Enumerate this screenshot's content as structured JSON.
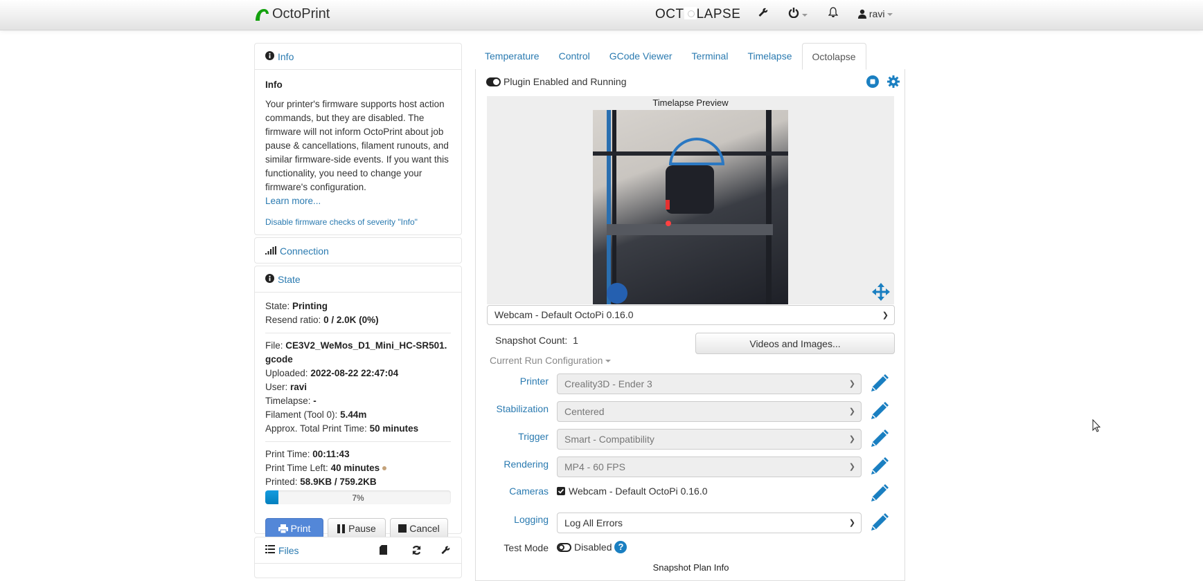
{
  "navbar": {
    "brand": "OctoPrint",
    "plugin_logo_left": "OCT",
    "plugin_logo_right": "LAPSE",
    "icons": [
      "wrench-icon",
      "power-icon",
      "bell-icon",
      "user-icon"
    ],
    "user": "ravi"
  },
  "sidebar": {
    "info_panel": {
      "title": "Info",
      "heading": "Info",
      "message": "Your printer's firmware supports host action commands, but they are disabled. The firmware will not inform OctoPrint about job pause & cancellations, filament runouts, and similar firmware-side events. If you want this functionality, you need to change your firmware's configuration.",
      "learn_more": "Learn more...",
      "disable_link": "Disable firmware checks of severity \"Info\""
    },
    "connection_panel": {
      "title": "Connection"
    },
    "state_panel": {
      "title": "State",
      "state_label": "State:",
      "state_value": "Printing",
      "resend_label": "Resend ratio:",
      "resend_value": "0 / 2.0K (0%)",
      "file_label": "File:",
      "file_value": "CE3V2_WeMos_D1_Mini_HC-SR501.gcode",
      "uploaded_label": "Uploaded:",
      "uploaded_value": "2022-08-22 22:47:04",
      "user_label": "User:",
      "user_value": "ravi",
      "timelapse_label": "Timelapse:",
      "timelapse_value": "-",
      "filament_label": "Filament (Tool 0):",
      "filament_value": "5.44m",
      "approx_label": "Approx. Total Print Time:",
      "approx_value": "50 minutes",
      "print_time_label": "Print Time:",
      "print_time_value": "00:11:43",
      "time_left_label": "Print Time Left:",
      "time_left_value": "40 minutes",
      "printed_label": "Printed:",
      "printed_value": "58.9KB / 759.2KB",
      "progress_percent": 7,
      "progress_text": "7%",
      "print_button": "Print",
      "pause_button": "Pause",
      "cancel_button": "Cancel"
    },
    "files_panel": {
      "title": "Files"
    }
  },
  "tabs": [
    "Temperature",
    "Control",
    "GCode Viewer",
    "Terminal",
    "Timelapse",
    "Octolapse"
  ],
  "active_tab": "Octolapse",
  "octolapse": {
    "plugin_status": "Plugin Enabled and Running",
    "preview_title": "Timelapse Preview",
    "camera_select": "Webcam - Default OctoPi 0.16.0",
    "snapshot_count_label": "Snapshot Count:",
    "snapshot_count_value": "1",
    "videos_button": "Videos and Images...",
    "current_run_config": "Current Run Configuration",
    "settings": [
      {
        "label": "Printer",
        "value": "Creality3D - Ender 3"
      },
      {
        "label": "Stabilization",
        "value": "Centered"
      },
      {
        "label": "Trigger",
        "value": "Smart - Compatibility"
      },
      {
        "label": "Rendering",
        "value": "MP4 - 60 FPS"
      }
    ],
    "cameras_label": "Cameras",
    "cameras_value": "Webcam - Default OctoPi 0.16.0",
    "logging_label": "Logging",
    "logging_value": "Log All Errors",
    "test_mode_label": "Test Mode",
    "test_mode_value": "Disabled",
    "snapshot_plan_info": "Snapshot Plan Info"
  },
  "colors": {
    "link": "#2a7ab0",
    "accent_blue": "#1a7fc1",
    "primary_button": "#5387d8",
    "logo_green": "#13c100"
  }
}
